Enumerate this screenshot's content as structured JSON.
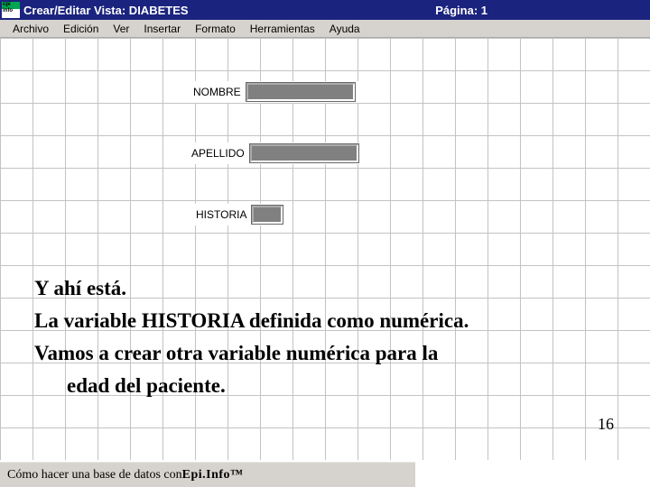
{
  "titlebar": {
    "title": "Crear/Editar Vista: DIABETES",
    "page_label": "Página: 1"
  },
  "menu": {
    "archivo": "Archivo",
    "edicion": "Edición",
    "ver": "Ver",
    "insertar": "Insertar",
    "formato": "Formato",
    "herramientas": "Herramientas",
    "ayuda": "Ayuda"
  },
  "fields": {
    "nombre": {
      "label": "NOMBRE",
      "value": ""
    },
    "apellido": {
      "label": "APELLIDO",
      "value": ""
    },
    "historia": {
      "label": "HISTORIA",
      "value": ""
    }
  },
  "tutorial": {
    "line1": "Y ahí está.",
    "line2": "La variable HISTORIA definida como numérica.",
    "line3a": "Vamos a crear otra variable numérica para la",
    "line3b": "edad del paciente."
  },
  "slide_number": "16",
  "footer": {
    "prefix": "Cómo hacer una base de datos con ",
    "product": "Epi.Info™"
  }
}
